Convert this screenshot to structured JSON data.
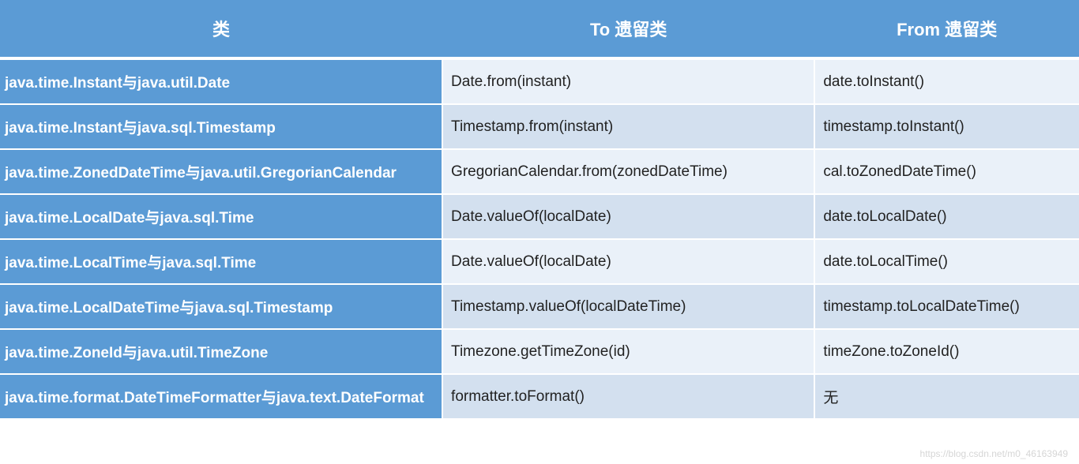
{
  "headers": {
    "col1": "类",
    "col2": "To 遗留类",
    "col3": "From 遗留类"
  },
  "rows": [
    {
      "class": "java.time.Instant与java.util.Date",
      "to": "Date.from(instant)",
      "from": "date.toInstant()"
    },
    {
      "class": "java.time.Instant与java.sql.Timestamp",
      "to": "Timestamp.from(instant)",
      "from": "timestamp.toInstant()"
    },
    {
      "class": "java.time.ZonedDateTime与java.util.GregorianCalendar",
      "to": "GregorianCalendar.from(zonedDateTime)",
      "from": "cal.toZonedDateTime()"
    },
    {
      "class": "java.time.LocalDate与java.sql.Time",
      "to": "Date.valueOf(localDate)",
      "from": "date.toLocalDate()"
    },
    {
      "class": "java.time.LocalTime与java.sql.Time",
      "to": "Date.valueOf(localDate)",
      "from": "date.toLocalTime()"
    },
    {
      "class": "java.time.LocalDateTime与java.sql.Timestamp",
      "to": "Timestamp.valueOf(localDateTime)",
      "from": "timestamp.toLocalDateTime()"
    },
    {
      "class": "java.time.ZoneId与java.util.TimeZone",
      "to": "Timezone.getTimeZone(id)",
      "from": "timeZone.toZoneId()"
    },
    {
      "class": "java.time.format.DateTimeFormatter与java.text.DateFormat",
      "to": "formatter.toFormat()",
      "from": "无"
    }
  ],
  "watermark": "https://blog.csdn.net/m0_46163949"
}
